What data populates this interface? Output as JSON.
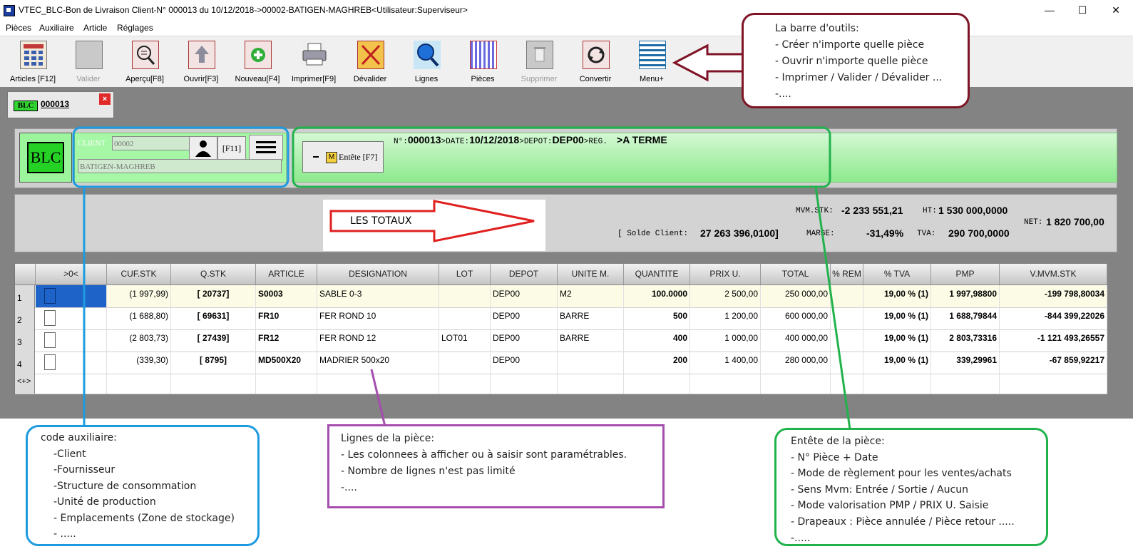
{
  "window": {
    "title": "VTEC_BLC-Bon de Livraison Client-N° 000013 du 10/12/2018->00002-BATIGEN-MAGHREB<Utilisateur:Superviseur>",
    "minimize": "—",
    "maximize": "☐",
    "close": "✕"
  },
  "menu": [
    "Pièces",
    "Auxiliaire",
    "Article",
    "Réglages"
  ],
  "toolbar": [
    {
      "label": "Articles [F12]",
      "icon": "articles-grid-icon",
      "enabled": true
    },
    {
      "label": "Valider",
      "icon": "validate-icon",
      "enabled": false
    },
    {
      "label": "Aperçu[F8]",
      "icon": "preview-magnifier-icon",
      "enabled": true
    },
    {
      "label": "Ouvrir[F3]",
      "icon": "open-arrow-up-icon",
      "enabled": true
    },
    {
      "label": "Nouveau[F4]",
      "icon": "new-plus-icon",
      "enabled": true
    },
    {
      "label": "Imprimer[F9]",
      "icon": "printer-icon",
      "enabled": true
    },
    {
      "label": "Dévalider",
      "icon": "unvalidate-cross-icon",
      "enabled": true
    },
    {
      "label": "Lignes",
      "icon": "lines-search-icon",
      "enabled": true
    },
    {
      "label": "Pièces",
      "icon": "pieces-grid-icon",
      "enabled": true
    },
    {
      "label": "Supprimer",
      "icon": "delete-trash-icon",
      "enabled": false
    },
    {
      "label": "Convertir",
      "icon": "convert-cycle-icon",
      "enabled": true
    },
    {
      "label": "Menu+",
      "icon": "menu-lines-icon",
      "enabled": true
    }
  ],
  "tab": {
    "badge": "BLC",
    "number": "000013",
    "close": "×"
  },
  "header": {
    "big_badge": "BLC",
    "client_label": "CLIENT",
    "client_code": "00002",
    "client_name": "BATIGEN-MAGHREB",
    "f11": "[F11]",
    "entete_button": "Entête [F7]",
    "entete_m": "M",
    "n_label": "N°:",
    "n_value": "000013",
    "date_label": ">DATE:",
    "date_value": "10/12/2018",
    "depot_label": ">DEPOT:",
    "depot_value": "DEP00",
    "reg_label": ">REG.",
    "reg_value": ">A TERME"
  },
  "totals": {
    "mvm_stk_label": "MVM.STK:",
    "mvm_stk": "-2 233 551,21",
    "ht_label": "HT:",
    "ht": "1 530 000,0000",
    "net_label": "NET:",
    "net": "1 820 700,00",
    "solde_label": "[ Solde Client:",
    "solde": "27 263 396,0100]",
    "marge_label": "MARGE:",
    "marge": "-31,49%",
    "tva_label": "TVA:",
    "tva": "290 700,0000",
    "annotation": "LES TOTAUX"
  },
  "grid": {
    "headers": [
      ">0<",
      "CUF.STK",
      "Q.STK",
      "ARTICLE",
      "DESIGNATION",
      "LOT",
      "DEPOT",
      "UNITE M.",
      "QUANTITE",
      "PRIX U.",
      "TOTAL",
      "% REM",
      "% TVA",
      "PMP",
      "V.MVM.STK"
    ],
    "rows": [
      {
        "n": "1",
        "cuf": "(1 997,99)",
        "qstk": "[ 20737]",
        "article": "S0003",
        "designation": "SABLE 0-3",
        "lot": "",
        "depot": "DEP00",
        "unite": "M2",
        "quantite": "100.0000",
        "prix": "2 500,00",
        "total": "250 000,00",
        "rem": "",
        "tva": "19,00 % (1)",
        "pmp": "1 997,98800",
        "vmvm": "-199 798,80034"
      },
      {
        "n": "2",
        "cuf": "(1 688,80)",
        "qstk": "[ 69631]",
        "article": "FR10",
        "designation": "FER ROND 10",
        "lot": "",
        "depot": "DEP00",
        "unite": "BARRE",
        "quantite": "500",
        "prix": "1 200,00",
        "total": "600 000,00",
        "rem": "",
        "tva": "19,00 % (1)",
        "pmp": "1 688,79844",
        "vmvm": "-844 399,22026"
      },
      {
        "n": "3",
        "cuf": "(2 803,73)",
        "qstk": "[ 27439]",
        "article": "FR12",
        "designation": "FER ROND 12",
        "lot": "LOT01",
        "depot": "DEP00",
        "unite": "BARRE",
        "quantite": "400",
        "prix": "1 000,00",
        "total": "400 000,00",
        "rem": "",
        "tva": "19,00 % (1)",
        "pmp": "2 803,73316",
        "vmvm": "-1 121 493,26557"
      },
      {
        "n": "4",
        "cuf": "(339,30)",
        "qstk": "[ 8795]",
        "article": "MD500X20",
        "designation": "MADRIER 500x20",
        "lot": "",
        "depot": "DEP00",
        "unite": "",
        "quantite": "200",
        "prix": "1 400,00",
        "total": "280 000,00",
        "rem": "",
        "tva": "19,00 % (1)",
        "pmp": "339,29961",
        "vmvm": "-67 859,92217"
      }
    ],
    "new_row": "<+>"
  },
  "notes": {
    "toolbar": [
      "La barre d'outils:",
      "- Créer n'importe quelle pièce",
      "- Ouvrir n'importe quelle pièce",
      "- Imprimer / Valider / Dévalider ...",
      "-...."
    ],
    "auxiliaire": [
      "code auxiliaire:",
      "-Client",
      "-Fournisseur",
      "-Structure de consommation",
      "-Unité de production",
      "- Emplacements (Zone de stockage)",
      "- ....."
    ],
    "lignes": [
      "Lignes de la pièce:",
      "- Les colonnees à afficher ou à saisir sont paramétrables.",
      "- Nombre de lignes n'est pas limité",
      "-...."
    ],
    "entete": [
      "Entête de la pièce:",
      "- N° Pièce + Date",
      "- Mode de règlement pour les ventes/achats",
      "- Sens Mvm: Entrée / Sortie / Aucun",
      "- Mode valorisation PMP / PRIX U. Saisie",
      "- Drapeaux : Pièce annulée /  Pièce retour .....",
      "-....."
    ]
  },
  "colors": {
    "workspace": "#838383",
    "header_green": "#a6f7a6",
    "note_blue": "#1e9be0",
    "note_green": "#22b24c",
    "note_purple": "#a64db0",
    "note_maroon": "#7f1426",
    "arrow_red": "#e02020"
  }
}
